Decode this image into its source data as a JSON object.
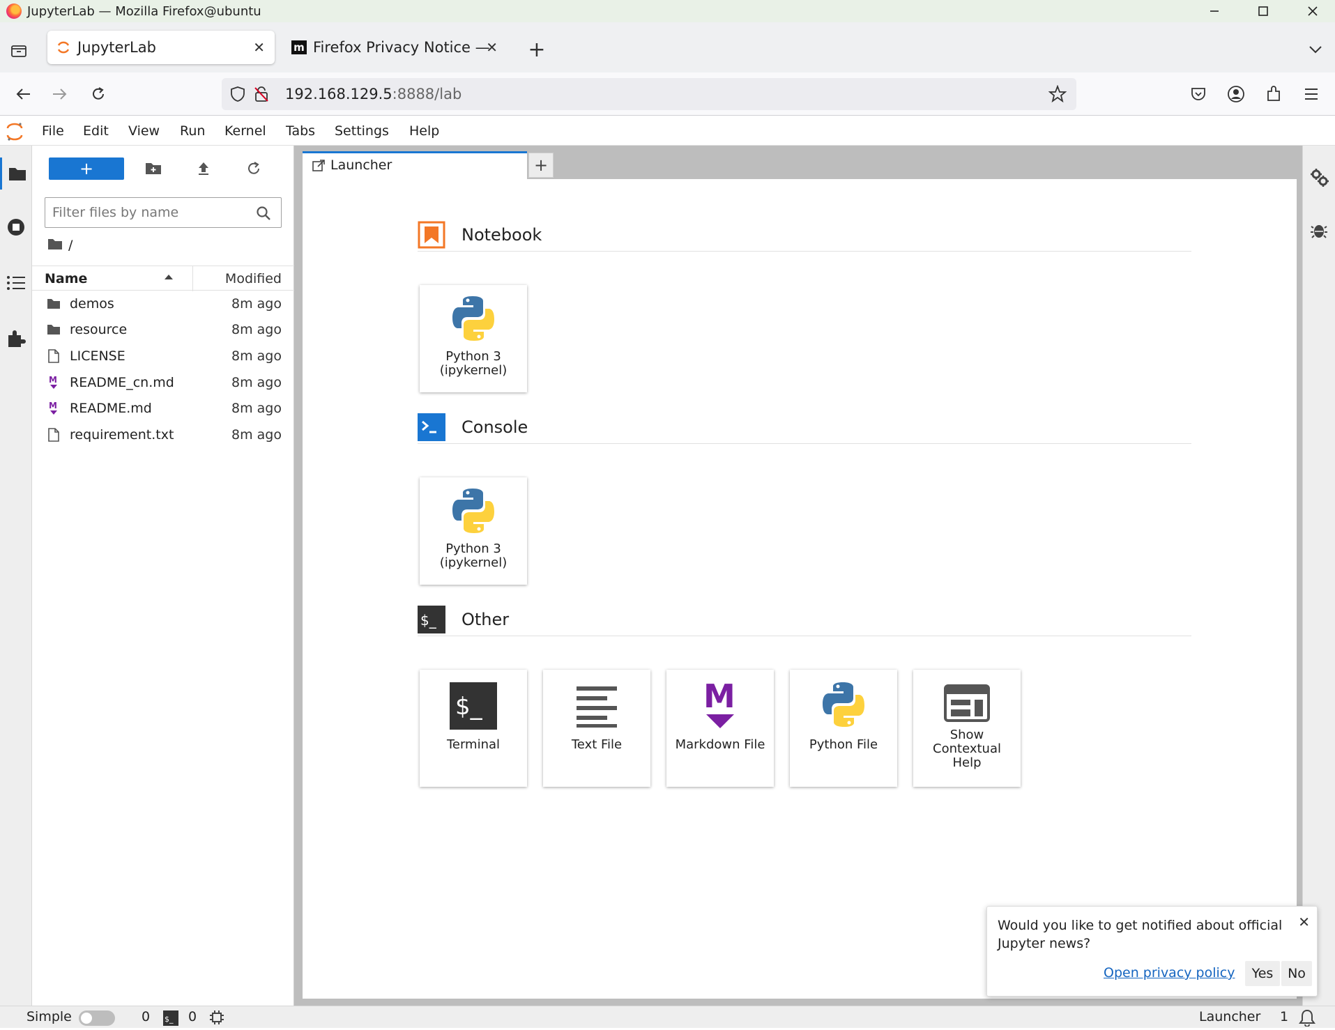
{
  "window": {
    "title": "JupyterLab — Mozilla Firefox@ubuntu"
  },
  "browser": {
    "tabs": [
      {
        "label": "JupyterLab",
        "active": true
      },
      {
        "label": "Firefox Privacy Notice —",
        "active": false
      }
    ],
    "url_host": "192.168.129.5",
    "url_path": ":8888/lab"
  },
  "menu": [
    "File",
    "Edit",
    "View",
    "Run",
    "Kernel",
    "Tabs",
    "Settings",
    "Help"
  ],
  "filebrowser": {
    "new_label": "+",
    "filter_placeholder": "Filter files by name",
    "breadcrumb": "/",
    "col_name": "Name",
    "col_modified": "Modified",
    "files": [
      {
        "name": "demos",
        "modified": "8m ago",
        "kind": "folder"
      },
      {
        "name": "resource",
        "modified": "8m ago",
        "kind": "folder"
      },
      {
        "name": "LICENSE",
        "modified": "8m ago",
        "kind": "file"
      },
      {
        "name": "README_cn.md",
        "modified": "8m ago",
        "kind": "markdown"
      },
      {
        "name": "README.md",
        "modified": "8m ago",
        "kind": "markdown"
      },
      {
        "name": "requirement.txt",
        "modified": "8m ago",
        "kind": "file"
      }
    ]
  },
  "dock": {
    "tab_label": "Launcher",
    "add_tab": "+"
  },
  "launcher": {
    "sections": [
      {
        "title": "Notebook",
        "cards": [
          "Python 3\n(ipykernel)"
        ]
      },
      {
        "title": "Console",
        "cards": [
          "Python 3\n(ipykernel)"
        ]
      },
      {
        "title": "Other",
        "cards": [
          "Terminal",
          "Text File",
          "Markdown File",
          "Python File",
          "Show\nContextual\nHelp"
        ]
      }
    ]
  },
  "notification": {
    "message": "Would you like to get notified about official Jupyter news?",
    "link": "Open privacy policy",
    "yes": "Yes",
    "no": "No"
  },
  "statusbar": {
    "mode": "Simple",
    "kernels": "0",
    "terminals": "0",
    "active_doc": "Launcher",
    "notifications": "1"
  },
  "colors": {
    "accent": "#1976d2",
    "notebook": "#f37726",
    "markdown": "#7b1fa2",
    "python_blue": "#3d75a8",
    "python_yellow": "#fdd13d"
  }
}
